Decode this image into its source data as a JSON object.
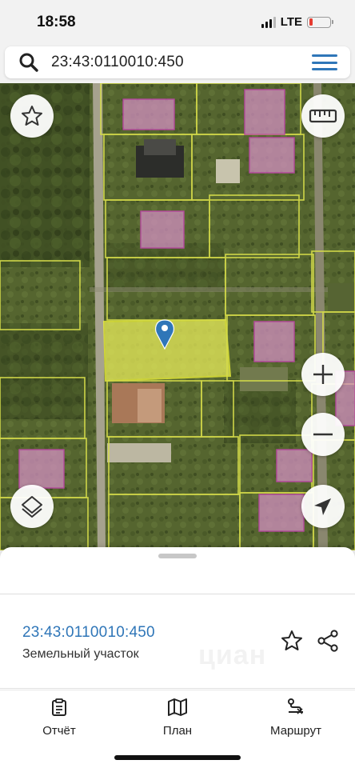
{
  "status_bar": {
    "time": "18:58",
    "network": "LTE",
    "battery_color": "#e63b30"
  },
  "search": {
    "query": "23:43:0110010:450",
    "search_icon": "search-icon",
    "menu_icon": "menu-icon",
    "accent": "#2f76b8"
  },
  "map": {
    "buttons": {
      "favorite": "star-icon",
      "measure": "ruler-icon",
      "zoom_in": "+",
      "zoom_out": "−",
      "layers": "layers-icon",
      "location": "navigation-arrow-icon"
    },
    "parcel_highlight_color": "#e8ec5a",
    "building_color": "#d28fc0",
    "marker_color": "#2f76b8"
  },
  "sheet": {
    "parcel_number": "23:43:0110010:450",
    "parcel_type": "Земельный участок",
    "watermark": "циан",
    "star_icon": "star-outline-icon",
    "share_icon": "share-icon"
  },
  "tabs": [
    {
      "label": "Отчёт",
      "icon": "report-icon"
    },
    {
      "label": "План",
      "icon": "map-icon"
    },
    {
      "label": "Маршрут",
      "icon": "route-icon"
    }
  ]
}
